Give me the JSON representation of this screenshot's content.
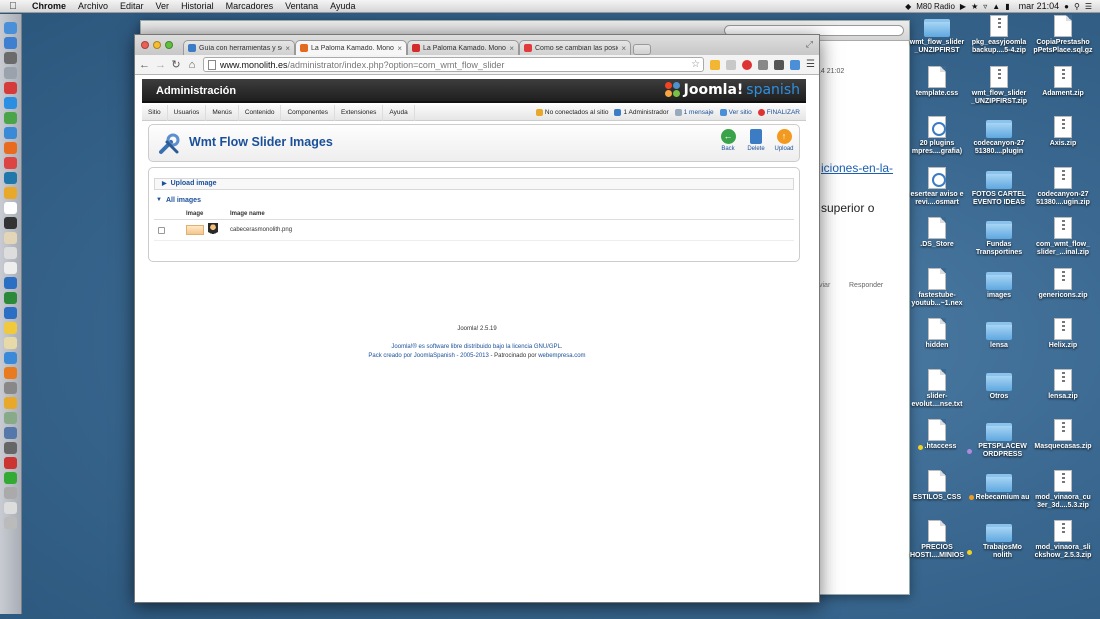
{
  "menubar": {
    "app": "Chrome",
    "items": [
      "Archivo",
      "Editar",
      "Ver",
      "Historial",
      "Marcadores",
      "Ventana",
      "Ayuda"
    ],
    "radio": "M80 Radio",
    "clock": "mar 21:04"
  },
  "background_window": {
    "date": "14 21:02",
    "link_text": "iciones-en-la-",
    "body_text": "superior o",
    "reenviar": "viar",
    "reply": "Responder"
  },
  "browser": {
    "tabs": [
      {
        "title": "Guía con herramientas y se",
        "favicon_color": "#3c7cc4",
        "active": false
      },
      {
        "title": "La Paloma Kamado. Monoli",
        "favicon_color": "#e26b1f",
        "active": true
      },
      {
        "title": "La Paloma Kamado. Monoli",
        "favicon_color": "#d62b2b",
        "active": false
      },
      {
        "title": "Como se cambian las posic",
        "favicon_color": "#e03c3c",
        "active": false
      }
    ],
    "url_host": "www.monolith.es",
    "url_rest": "/administrator/index.php?option=com_wmt_flow_slider"
  },
  "admin": {
    "header_title": "Administración",
    "logo_text": "Joomla!",
    "logo_suffix": "spanish",
    "menu": [
      "Sitio",
      "Usuarios",
      "Menús",
      "Contenido",
      "Componentes",
      "Extensiones",
      "Ayuda"
    ],
    "status": {
      "visitors": "No conectados al sitio",
      "admins": "1 Administrador",
      "messages": "1 mensaje",
      "view_site": "Ver sitio",
      "logout": "FINALIZAR"
    },
    "page_title": "Wmt Flow Slider Images",
    "buttons": {
      "back": "Back",
      "delete": "Delete",
      "upload": "Upload"
    },
    "upload_section": "Upload image",
    "all_images_section": "All images",
    "table": {
      "headers": [
        "Image",
        "Image name"
      ],
      "rows": [
        {
          "name": "cabecerasmonolith.png"
        }
      ]
    },
    "footer": {
      "version": "Joomla! 2.5.19",
      "license": "Joomla!® es software libre distribuido bajo la licencia GNU/GPL.",
      "pack": "Pack creado por JoomlaSpanish - 2005-2013",
      "sponsor_prefix": " - Patrocinado por ",
      "sponsor": "webempresa.com"
    }
  },
  "desktop": {
    "icons": [
      {
        "label": "wmt_flow_slider _UNZIPFIRST",
        "type": "folder"
      },
      {
        "label": "pkg_easyjoomla backup....5-4.zip",
        "type": "zip"
      },
      {
        "label": "CopiaPrestasho pPetsPlace.sql.gz",
        "type": "doc"
      },
      {
        "label": "template.css",
        "type": "doc"
      },
      {
        "label": "wmt_flow_slider _UNZIPFIRST.zip",
        "type": "zip"
      },
      {
        "label": "Adament.zip",
        "type": "zip"
      },
      {
        "label": "20 plugins mpres....grafia)",
        "type": "app"
      },
      {
        "label": "codecanyon-27 51380....plugin",
        "type": "folder"
      },
      {
        "label": "Axis.zip",
        "type": "zip"
      },
      {
        "label": "esertear aviso e revi....osmart",
        "type": "app"
      },
      {
        "label": "FOTOS CARTEL EVENTO IDEAS",
        "type": "folder"
      },
      {
        "label": "codecanyon-27 51380....ugin.zip",
        "type": "zip"
      },
      {
        "label": ".DS_Store",
        "type": "doc"
      },
      {
        "label": "Fundas Transportines",
        "type": "folder"
      },
      {
        "label": "com_wmt_flow_ slider_...inal.zip",
        "type": "zip"
      },
      {
        "label": "fastestube- youtub...~1.nex",
        "type": "doc"
      },
      {
        "label": "images",
        "type": "folder"
      },
      {
        "label": "genericons.zip",
        "type": "zip"
      },
      {
        "label": "hidden",
        "type": "doc"
      },
      {
        "label": "lensa",
        "type": "folder"
      },
      {
        "label": "Helix.zip",
        "type": "zip"
      },
      {
        "label": "slider- evolut....nse.txt",
        "type": "doc"
      },
      {
        "label": "Otros",
        "type": "folder"
      },
      {
        "label": "lensa.zip",
        "type": "zip"
      },
      {
        "label": ".htaccess",
        "type": "doc",
        "tag": "#f2d21f"
      },
      {
        "label": "PETSPLACEW ORDPRESS",
        "type": "folder",
        "tag": "#b08adf"
      },
      {
        "label": "Masquecasas.zip",
        "type": "zip"
      },
      {
        "label": "ESTILOS_CSS",
        "type": "doc"
      },
      {
        "label": "Rebecamium au",
        "type": "folder",
        "tag": "#f29a1f"
      },
      {
        "label": "mod_vinaora_cu 3er_3d....5.3.zip",
        "type": "zip"
      },
      {
        "label": "PRECIOS HOSTI....MINIOS",
        "type": "doc"
      },
      {
        "label": "TrabajosMo nolith",
        "type": "folder",
        "tag": "#f2d21f"
      },
      {
        "label": "mod_vinaora_sli ckshow_2.5.3.zip",
        "type": "zip"
      }
    ]
  }
}
